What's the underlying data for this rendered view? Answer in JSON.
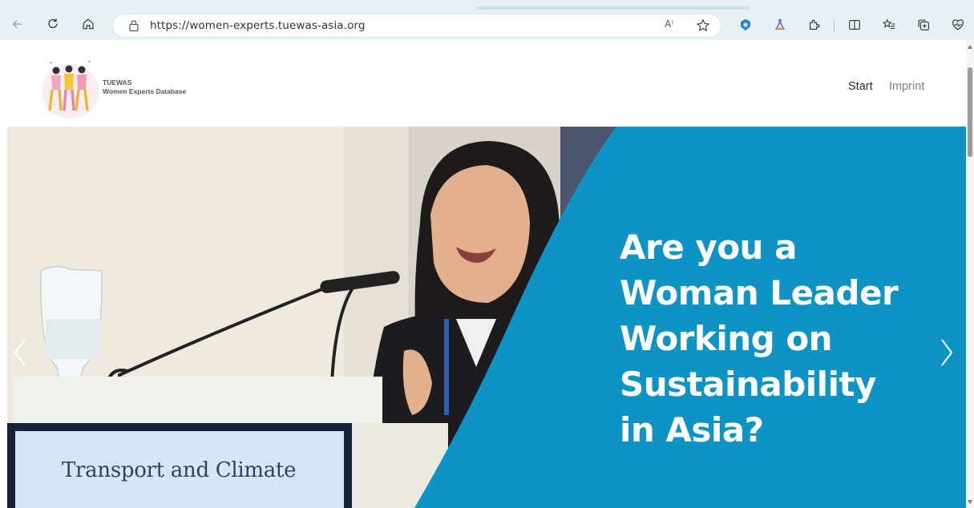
{
  "browser": {
    "url": "https://women-experts.tuewas-asia.org",
    "read_aloud_label": "A⁾",
    "buttons": [
      "back-icon",
      "refresh-icon",
      "home-icon",
      "favorite-star-icon",
      "extension-shield-icon",
      "lab-flask-icon",
      "puzzle-extensions-icon",
      "split-screen-icon",
      "favorites-list-icon",
      "collections-icon",
      "heart-pulse-icon"
    ]
  },
  "site": {
    "brand_line1": "TUEWAS",
    "brand_line2": "Women Experts Database",
    "nav": [
      {
        "label": "Start"
      },
      {
        "label": "Imprint"
      }
    ]
  },
  "hero": {
    "headline_lines": [
      "Are you a",
      "Woman Leader",
      "Working on",
      "Sustainability",
      "in Asia?"
    ],
    "podium_sign": "Transport and Climate",
    "accent_color": "#0e94c4"
  }
}
